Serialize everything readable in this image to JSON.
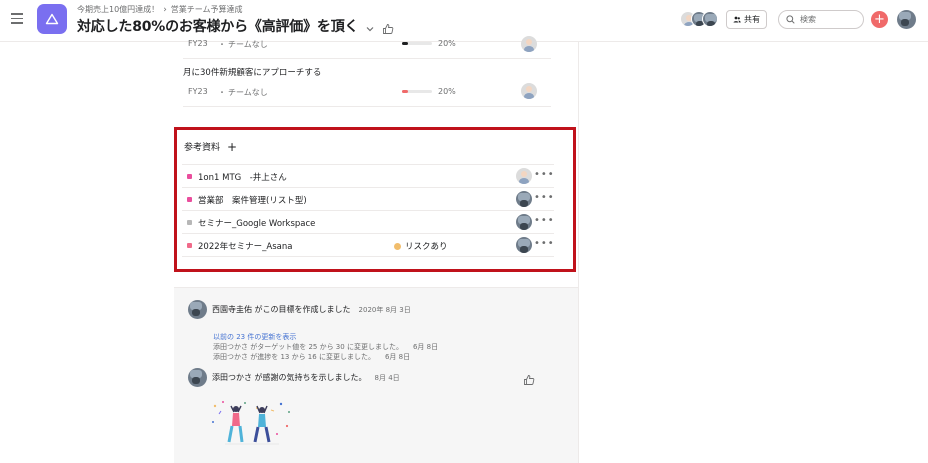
{
  "header": {
    "breadcrumbs": [
      "今期売上10億円達成！",
      "営業チーム予算達成"
    ],
    "title": "対応した80%のお客様から《高評価》を頂く",
    "share_label": "共有",
    "search_placeholder": "検索"
  },
  "goals": [
    {
      "title": "",
      "period": "FY23",
      "team": "チームなし",
      "progress_percent": 20,
      "progress_label": "20%",
      "progress_color": "#1e1f21"
    },
    {
      "title": "月に30件新規顧客にアプローチする",
      "period": "FY23",
      "team": "チームなし",
      "progress_percent": 20,
      "progress_label": "20%",
      "progress_color": "#f06a6a"
    }
  ],
  "references": {
    "heading": "参考資料",
    "items": [
      {
        "label": "1on1 MTG　-井上さん",
        "color": "#ea4e9d",
        "status": "",
        "status_color": ""
      },
      {
        "label": "営業部　案件管理(リスト型)",
        "color": "#ea4e9d",
        "status": "",
        "status_color": ""
      },
      {
        "label": "セミナー_Google Workspace",
        "color": "#b7b7b7",
        "status": "",
        "status_color": ""
      },
      {
        "label": "2022年セミナー_Asana",
        "color": "#f06a8a",
        "status": "リスクあり",
        "status_color": "#f1bd6c"
      }
    ]
  },
  "feed": {
    "created_text": "西園寺圭佑 がこの目標を作成しました",
    "created_date": "2020年 8月 3日",
    "show_more": "以前の 23 件の更新を表示",
    "updates": [
      {
        "text": "添田つかさ がターゲット値を 25 から 30 に変更しました。",
        "date": "6月 8日"
      },
      {
        "text": "添田つかさ が進捗を 13 から 16 に変更しました。",
        "date": "6月 8日"
      }
    ],
    "thanks_text": "添田つかさ が感謝の気持ちを示しました。",
    "thanks_date": "8月 4日"
  },
  "icons": {
    "menu": "menu-icon",
    "app": "goal-triangle-icon",
    "breadcrumb_sep": "chevron-right-icon",
    "title_dropdown": "chevron-down-icon",
    "title_like": "thumbs-up-icon",
    "share": "people-icon",
    "search": "search-icon",
    "add": "plus-icon",
    "more": "more-horizontal-icon"
  },
  "colors": {
    "app_icon": "#7a6ff0",
    "add_button": "#f06a6a",
    "highlight_border": "#c0121b",
    "link": "#4573d2"
  }
}
